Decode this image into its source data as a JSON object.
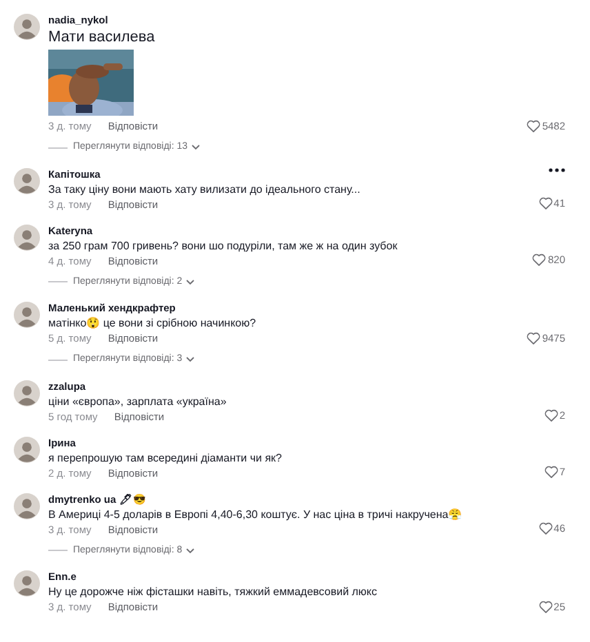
{
  "comments": [
    {
      "username": "nadia_nykol",
      "text": "Мати василева",
      "large": true,
      "time": "3 д. тому",
      "reply": "Відповісти",
      "likes": "5482",
      "more_menu": false,
      "replies": "Переглянути відповіді: 13"
    },
    {
      "username": "Капітошка",
      "text": "За таку ціну вони мають хату вилизати до ідеального стану...",
      "large": false,
      "time": "3 д. тому",
      "reply": "Відповісти",
      "likes": "41",
      "more_menu": true
    },
    {
      "username": "Kateryna",
      "text": "за 250 грам 700 гривень? вони шо подуріли, там же ж на один зубок",
      "large": false,
      "time": "4 д. тому",
      "reply": "Відповісти",
      "likes": "820",
      "more_menu": false,
      "replies": "Переглянути відповіді: 2"
    },
    {
      "username": "Маленький хендкрафтер",
      "text": "матінко😲 це вони зі срібною начинкою?",
      "large": false,
      "time": "5 д. тому",
      "reply": "Відповісти",
      "likes": "9475",
      "more_menu": false,
      "replies": "Переглянути відповіді: 3"
    },
    {
      "username": "zzalupa",
      "text": "ціни «європа», зарплата «україна»",
      "large": false,
      "time": "5 год тому",
      "reply": "Відповісти",
      "likes": "2",
      "more_menu": false
    },
    {
      "username": "Ірина",
      "text": "я перепрошую там всередині діаманти чи як?",
      "large": false,
      "time": "2 д. тому",
      "reply": "Відповісти",
      "likes": "7",
      "more_menu": false
    },
    {
      "username": "dmytrenko ua 🖊😎",
      "text": "В Америці 4-5 доларів в Европі 4,40-6,30 коштує. У нас ціна в тричі накручена😤",
      "large": false,
      "time": "3 д. тому",
      "reply": "Відповісти",
      "likes": "46",
      "more_menu": false,
      "replies": "Переглянути відповіді: 8"
    },
    {
      "username": "Enn.e",
      "text": "Ну це дорожче ніж фісташки навіть, тяжкий еммадевсовий люкс",
      "large": false,
      "time": "3 д. тому",
      "reply": "Відповісти",
      "likes": "25",
      "more_menu": false
    }
  ]
}
